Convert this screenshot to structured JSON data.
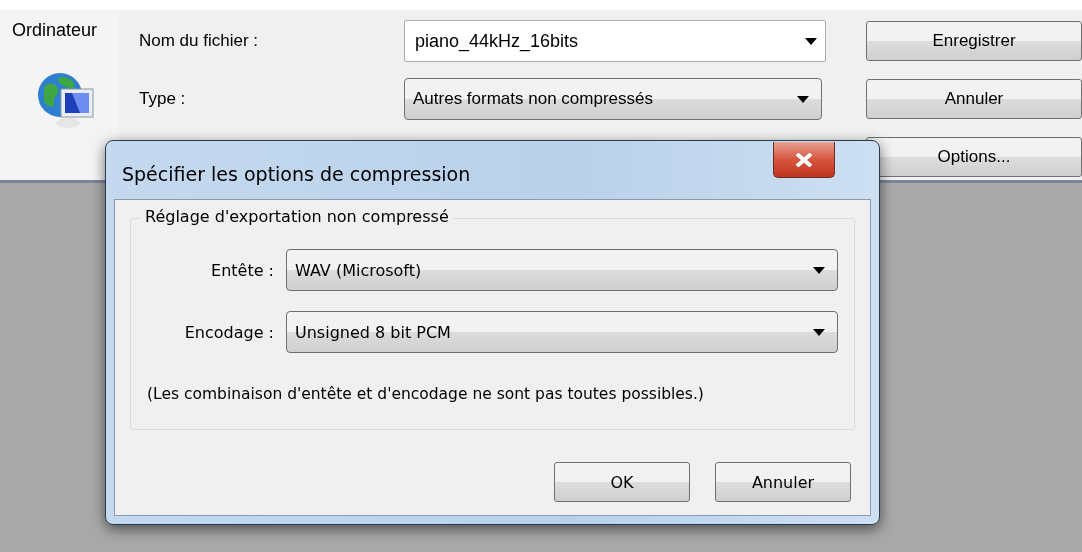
{
  "file_dialog": {
    "sidebar": {
      "items": [
        {
          "label": "Ordinateur"
        }
      ]
    },
    "fields": [
      {
        "label": "Nom du fichier :",
        "value": "piano_44kHz_16bits",
        "kind": "editable"
      },
      {
        "label": "Type :",
        "value": "Autres formats non compressés",
        "kind": "dropdown"
      }
    ],
    "buttons": [
      "Enregistrer",
      "Annuler",
      "Options..."
    ]
  },
  "dialog": {
    "title": "Spécifier les options de compression",
    "group": {
      "title": "Réglage d'exportation non compressé",
      "fields": [
        {
          "label": "Entête :",
          "value": "WAV (Microsoft)"
        },
        {
          "label": "Encodage :",
          "value": "Unsigned 8 bit PCM"
        }
      ],
      "note": "(Les combinaison d'entête et d'encodage ne sont pas toutes possibles.)"
    },
    "buttons": [
      "OK",
      "Annuler"
    ]
  }
}
